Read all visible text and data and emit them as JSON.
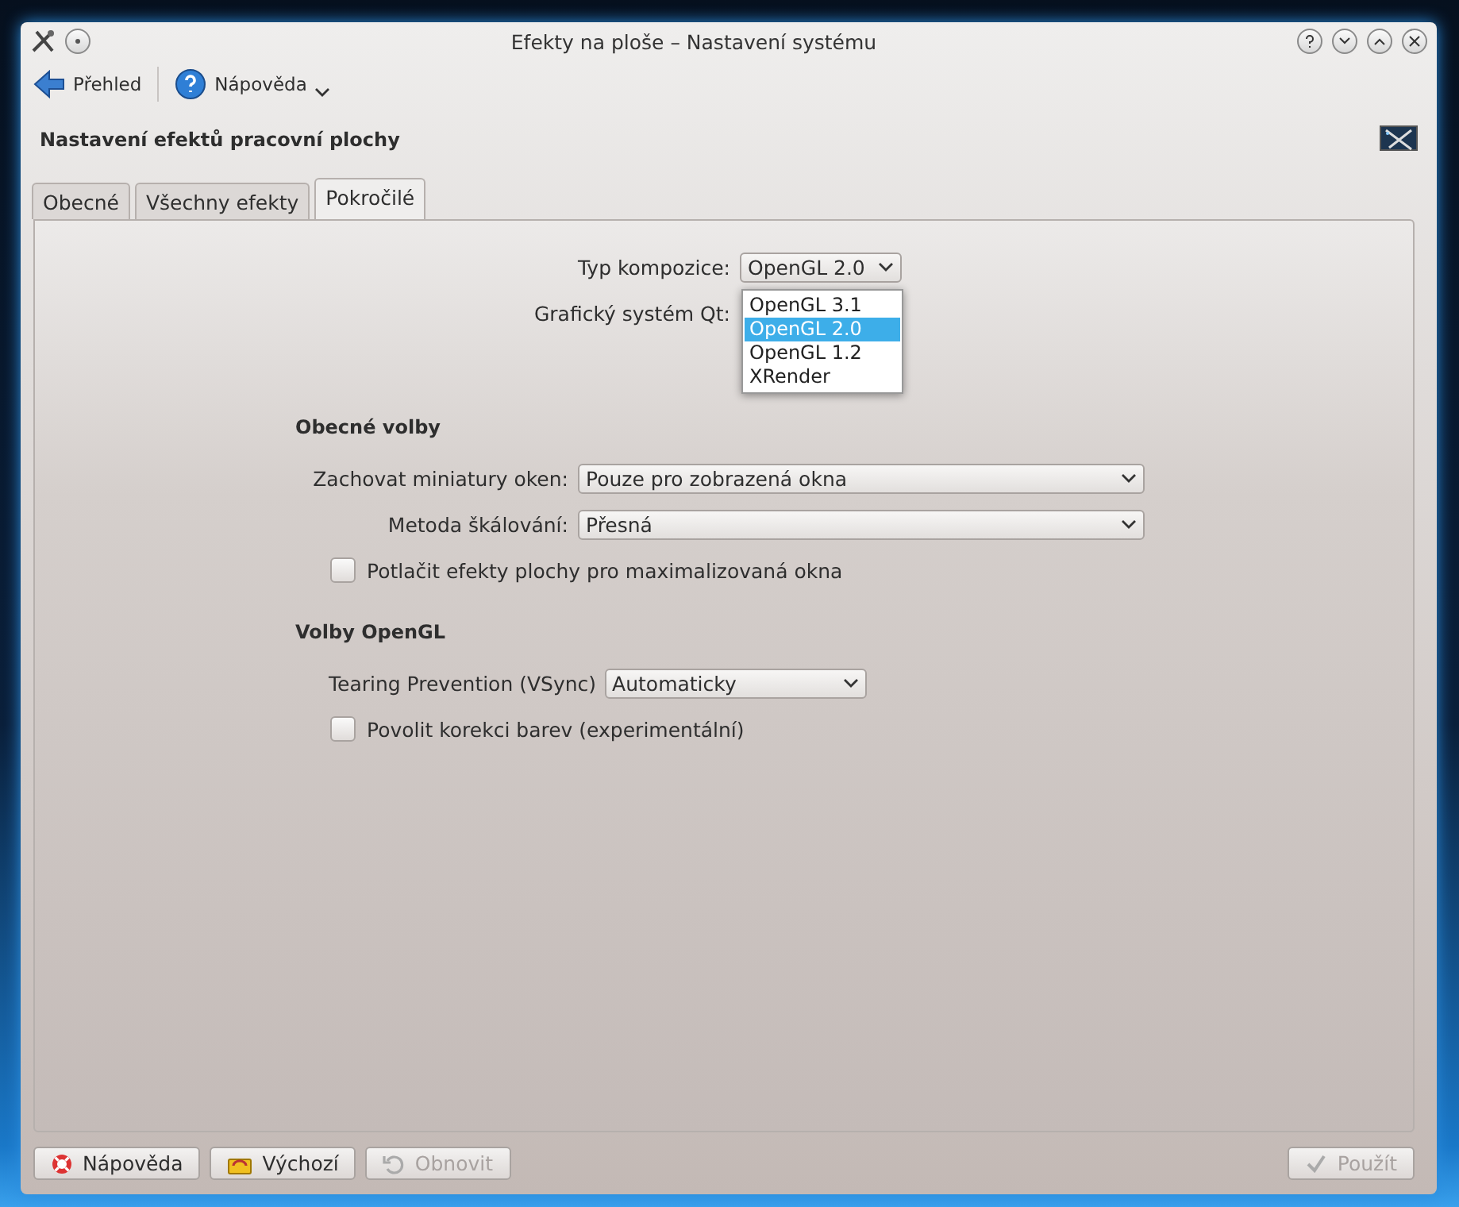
{
  "window": {
    "title": "Efekty na ploše – Nastavení systému"
  },
  "toolbar": [
    {
      "label": "Přehled",
      "kind": "back"
    },
    {
      "label": "Nápověda",
      "kind": "help",
      "menu": true
    }
  ],
  "header": {
    "title": "Nastavení efektů pracovní plochy"
  },
  "tabs": [
    {
      "label": "Obecné",
      "selected": false
    },
    {
      "label": "Všechny efekty",
      "selected": false
    },
    {
      "label": "Pokročilé",
      "selected": true
    }
  ],
  "compositing": {
    "label": "Typ kompozice:",
    "value": "OpenGL 2.0",
    "options": [
      {
        "label": "OpenGL 3.1",
        "selected": false
      },
      {
        "label": "OpenGL 2.0",
        "selected": true
      },
      {
        "label": "OpenGL 1.2",
        "selected": false
      },
      {
        "label": "XRender",
        "selected": false
      }
    ]
  },
  "qt_system": {
    "label": "Grafický systém Qt:"
  },
  "sections": [
    {
      "title": "Obecné volby",
      "rows": [
        {
          "kind": "select",
          "label": "Zachovat miniatury oken:",
          "value": "Pouze pro zobrazená okna"
        },
        {
          "kind": "select",
          "label": "Metoda škálování:",
          "value": "Přesná"
        },
        {
          "kind": "checkbox",
          "label": "Potlačit efekty plochy pro maximalizovaná okna",
          "checked": false
        }
      ]
    },
    {
      "title": "Volby OpenGL",
      "rows": [
        {
          "kind": "inline-select",
          "label": "Tearing Prevention (VSync)",
          "value": "Automaticky"
        },
        {
          "kind": "checkbox",
          "label": "Povolit korekci barev (experimentální)",
          "checked": false
        }
      ]
    }
  ],
  "buttons": [
    {
      "label": "Nápověda",
      "kind": "help",
      "disabled": false
    },
    {
      "label": "Výchozí",
      "kind": "defaults",
      "disabled": false
    },
    {
      "label": "Obnovit",
      "kind": "reset",
      "disabled": true
    },
    {
      "label": "Použít",
      "kind": "apply",
      "disabled": true
    }
  ]
}
